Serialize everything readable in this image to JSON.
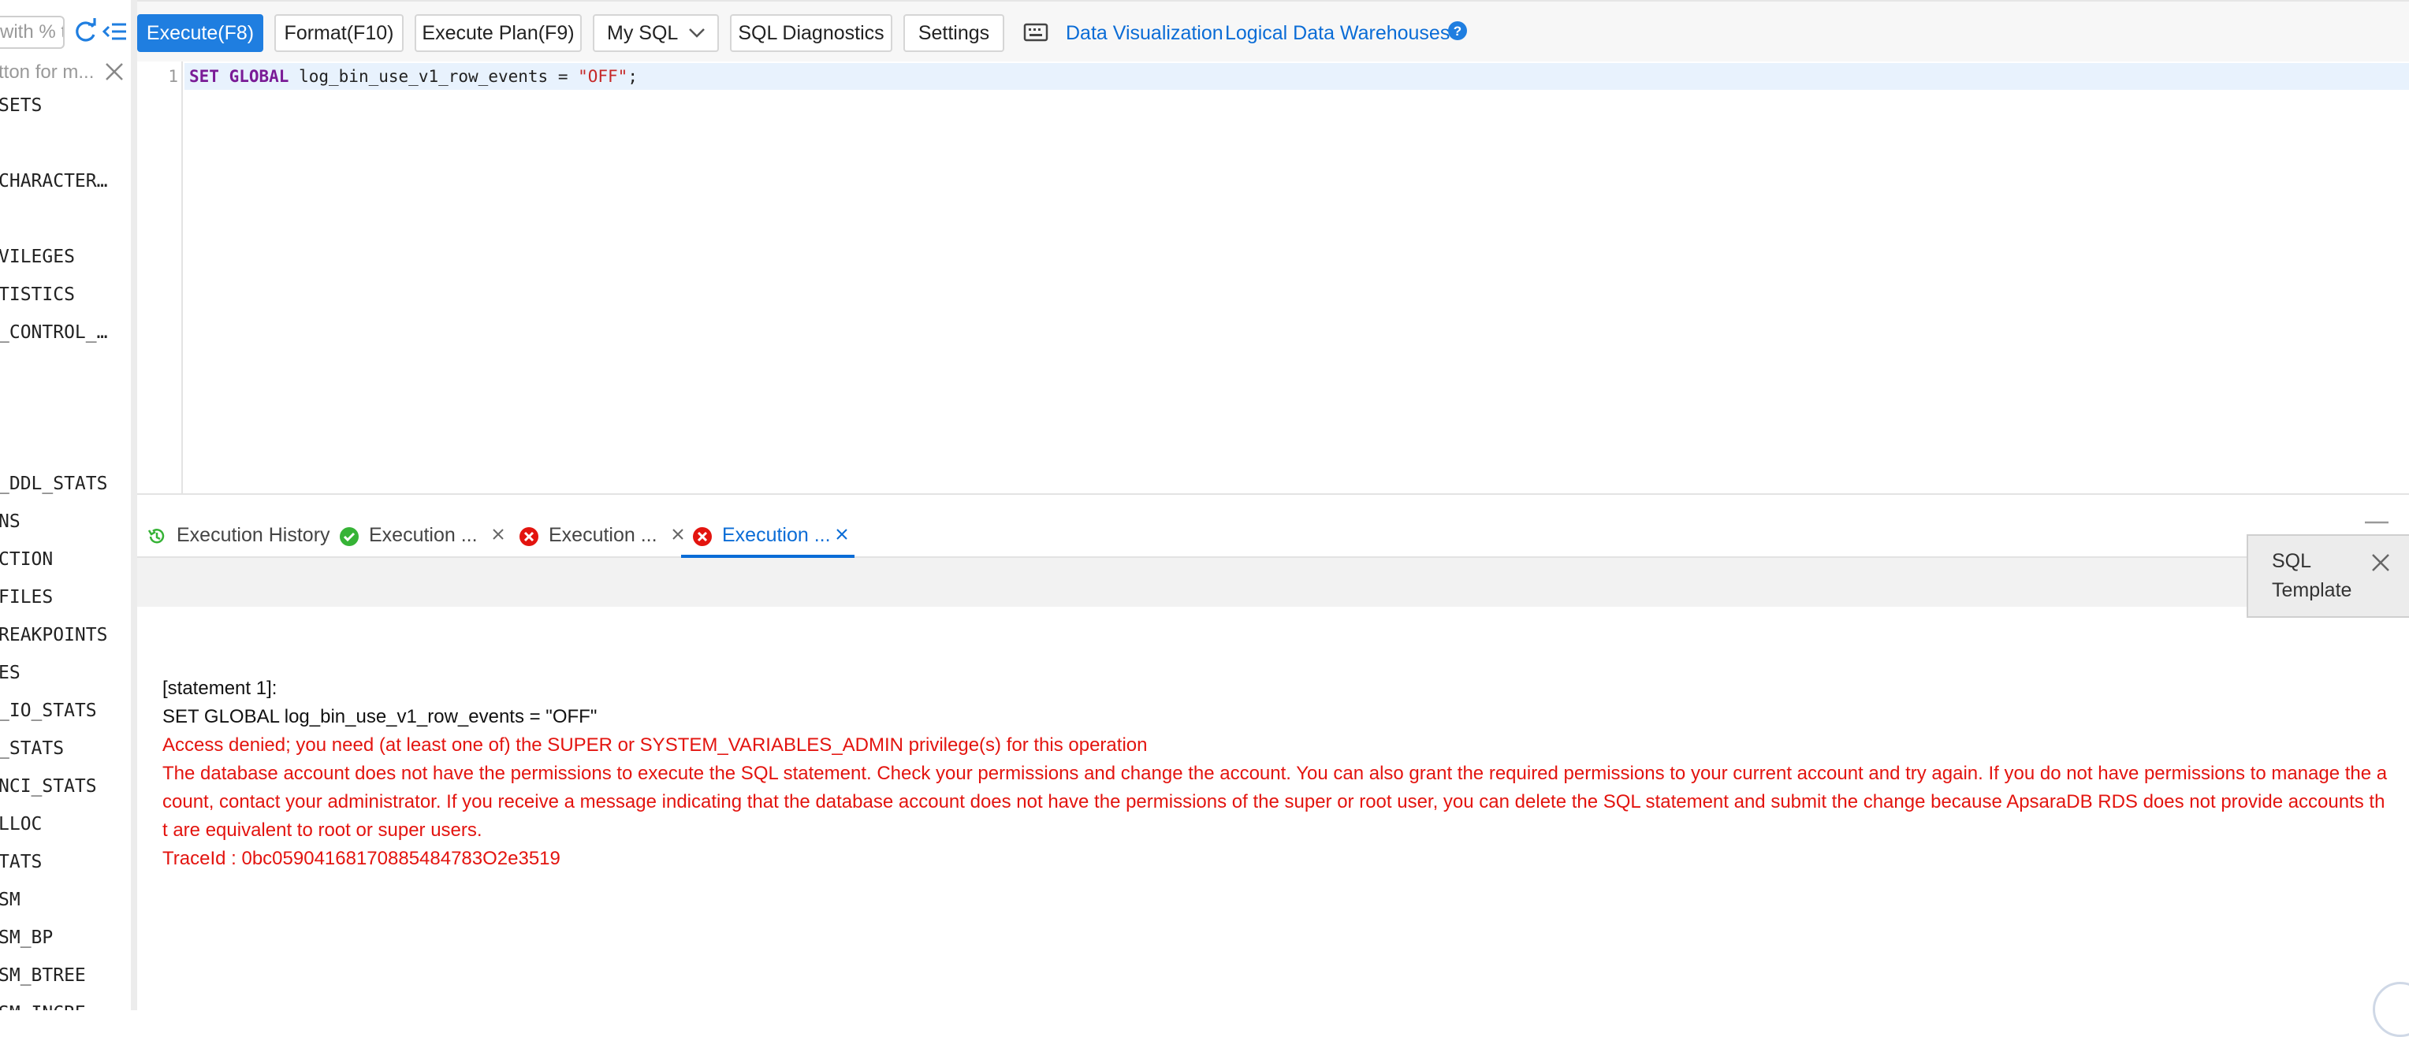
{
  "sidebar": {
    "search_placeholder": "with % t",
    "filter_text": "tton for m...",
    "items": [
      {
        "label": "SETS",
        "top": 0
      },
      {
        "label": "CHARACTER..."
      },
      {
        "label": "VILEGES"
      },
      {
        "label": "TISTICS"
      },
      {
        "label": "_CONTROL_..."
      },
      {
        "label": "_DDL_STATS"
      },
      {
        "label": "NS"
      },
      {
        "label": "CTION"
      },
      {
        "label": "FILES"
      },
      {
        "label": "REAKPOINTS"
      },
      {
        "label": "ES"
      },
      {
        "label": "_IO_STATS"
      },
      {
        "label": "_STATS"
      },
      {
        "label": "NCI_STATS"
      },
      {
        "label": "LLOC"
      },
      {
        "label": "TATS"
      },
      {
        "label": "SM"
      },
      {
        "label": "SM_BP"
      },
      {
        "label": "SM_BTREE"
      },
      {
        "label": "SM_INCRE"
      }
    ]
  },
  "toolbar": {
    "execute": "Execute(F8)",
    "format": "Format(F10)",
    "execute_plan": "Execute Plan(F9)",
    "dialect": "My SQL",
    "diagnostics": "SQL Diagnostics",
    "settings": "Settings",
    "link_visualization": "Data Visualization",
    "link_ldw": "Logical Data Warehouses"
  },
  "editor": {
    "line_number": "1",
    "kw_set": "SET",
    "kw_global": "GLOBAL",
    "identifier": " log_bin_use_v1_row_events = ",
    "string_value": "\"OFF\"",
    "terminator": ";"
  },
  "results_tabs": {
    "history": "Execution History",
    "tab1": "Execution ...",
    "tab2": "Execution ...",
    "tab3": "Execution ..."
  },
  "results": {
    "statement_header": "[statement 1]:",
    "statement_sql": "SET GLOBAL log_bin_use_v1_row_events = \"OFF\"",
    "error_message": "Access denied; you need (at least one of) the SUPER or SYSTEM_VARIABLES_ADMIN privilege(s) for this operation",
    "detail_line1": "The database account does not have the permissions to execute the SQL statement. Check your permissions and change the account. You can also grant the required permissions to your current account and try again. If you do not have permissions to manage the a",
    "detail_line2": "count, contact your administrator. If you receive a message indicating that the database account does not have the permissions of the super or root user, you can delete the SQL statement and submit the change because ApsaraDB RDS does not provide accounts th",
    "detail_line3": "t are equivalent to root or super users.",
    "trace_id": "TraceId : 0bc05904168170885484783О2e3519"
  },
  "sql_template": {
    "label": "SQL Template"
  },
  "colors": {
    "primary": "#1f7ee0",
    "link": "#0a6cd6",
    "error": "#e3140f",
    "success": "#36b336"
  }
}
